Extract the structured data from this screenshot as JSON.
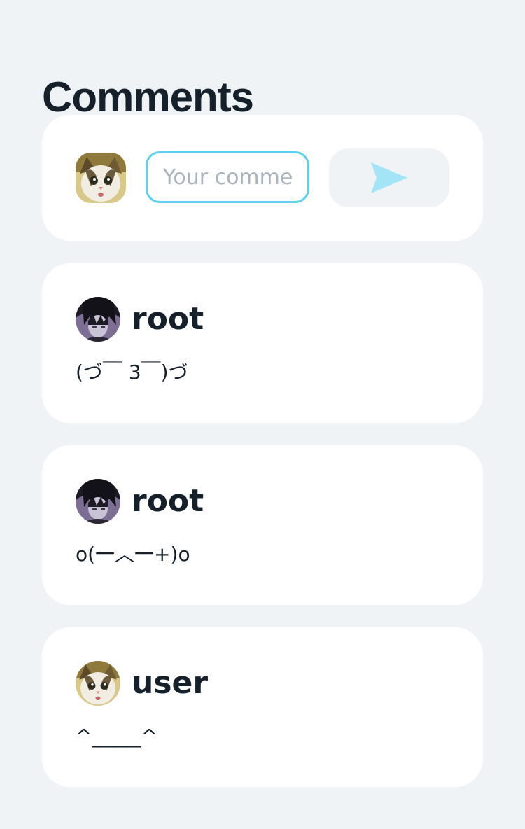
{
  "page": {
    "title": "Comments"
  },
  "composer": {
    "placeholder": "Your comment",
    "value": "",
    "avatar_icon": "cat-avatar-icon",
    "send_icon": "send-icon",
    "send_icon_color": "#a3e4f7",
    "input_border_color": "#5fd1ee"
  },
  "comments": [
    {
      "username": "root",
      "text": "(づ￣ 3￣)づ",
      "avatar_icon": "dark-hair-avatar-icon"
    },
    {
      "username": "root",
      "text": "o(一︿一+)o",
      "avatar_icon": "dark-hair-avatar-icon"
    },
    {
      "username": "user",
      "text": "^_____^",
      "avatar_icon": "cat-avatar-icon"
    }
  ],
  "colors": {
    "background": "#eff3f6",
    "card": "#ffffff",
    "text": "#15202b"
  }
}
